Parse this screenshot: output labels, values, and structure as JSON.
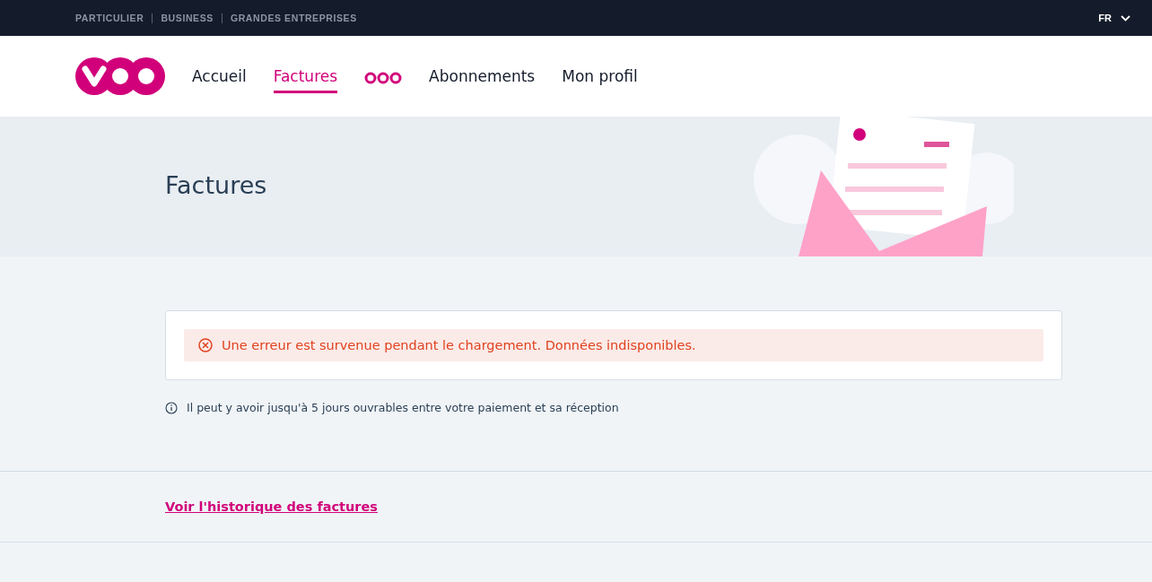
{
  "top_bar": {
    "segments": [
      "PARTICULIER",
      "BUSINESS",
      "GRANDES ENTREPRISES"
    ],
    "language": "FR"
  },
  "nav": {
    "items": [
      {
        "kind": "text",
        "label": "Accueil",
        "selected": false
      },
      {
        "kind": "text",
        "label": "Factures",
        "selected": true
      },
      {
        "kind": "dots",
        "selected": false
      },
      {
        "kind": "text",
        "label": "Abonnements",
        "selected": false
      },
      {
        "kind": "text",
        "label": "Mon profil",
        "selected": false
      }
    ]
  },
  "hero": {
    "title": "Factures"
  },
  "error": {
    "message": "Une erreur est survenue pendant le chargement. Données indisponibles."
  },
  "info": {
    "text": "Il peut y avoir jusqu'à 5 jours ouvrables entre votre paiement et sa réception"
  },
  "history_link": "Voir l'historique des factures"
}
